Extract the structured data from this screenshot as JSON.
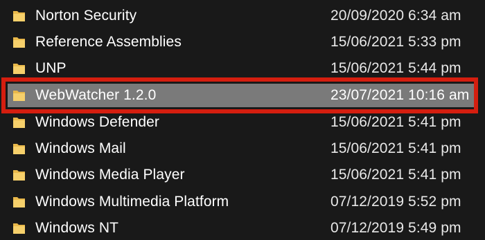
{
  "colors": {
    "background": "#191919",
    "selected_row": "#7a7a7a",
    "highlight_border": "#d51e0f",
    "folder_icon": "#f2c75c"
  },
  "folders": [
    {
      "name": "Norton Security",
      "date_modified": "20/09/2020 6:34 am",
      "icon": "folder-icon"
    },
    {
      "name": "Reference Assemblies",
      "date_modified": "15/06/2021 5:33 pm",
      "icon": "folder-icon"
    },
    {
      "name": "UNP",
      "date_modified": "15/06/2021 5:44 pm",
      "icon": "folder-icon"
    },
    {
      "name": "WebWatcher 1.2.0",
      "date_modified": "23/07/2021 10:16 am",
      "icon": "folder-icon",
      "selected": true
    },
    {
      "name": "Windows Defender",
      "date_modified": "15/06/2021 5:41 pm",
      "icon": "folder-icon"
    },
    {
      "name": "Windows Mail",
      "date_modified": "15/06/2021 5:41 pm",
      "icon": "folder-icon"
    },
    {
      "name": "Windows Media Player",
      "date_modified": "15/06/2021 5:41 pm",
      "icon": "folder-icon"
    },
    {
      "name": "Windows Multimedia Platform",
      "date_modified": "07/12/2019 5:52 pm",
      "icon": "folder-icon"
    },
    {
      "name": "Windows NT",
      "date_modified": "07/12/2019 5:49 pm",
      "icon": "folder-icon"
    }
  ]
}
